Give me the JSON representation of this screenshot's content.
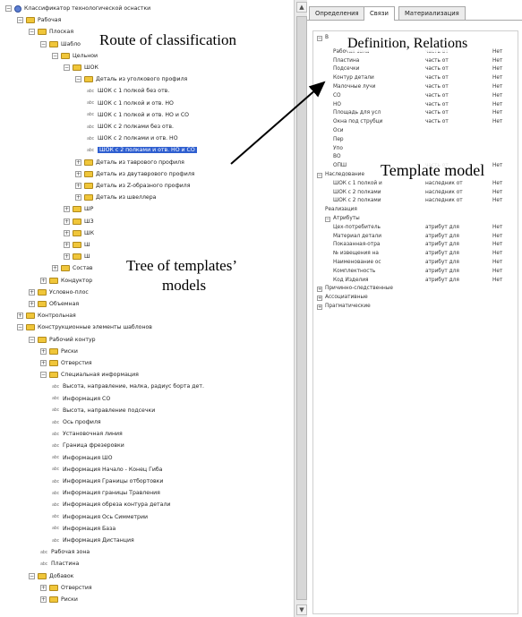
{
  "left_tree": [
    {
      "label": "Классификатор технологической оснастки",
      "indent": 0,
      "icon": "globe",
      "exp": "-"
    },
    {
      "label": "Рабочая",
      "indent": 1,
      "icon": "folder",
      "exp": "-"
    },
    {
      "label": "Плоская",
      "indent": 2,
      "icon": "folder",
      "exp": "-"
    },
    {
      "label": "Шабло",
      "indent": 3,
      "icon": "folder",
      "exp": "-"
    },
    {
      "label": "Цельнои",
      "indent": 4,
      "icon": "folder",
      "exp": "-"
    },
    {
      "label": "ШОК",
      "indent": 5,
      "icon": "folder",
      "exp": "-"
    },
    {
      "label": "Деталь из уголкового профиля",
      "indent": 6,
      "icon": "folder",
      "exp": "-"
    },
    {
      "label": "ШОК с 1 полкой без отв.",
      "indent": 7,
      "icon": "leaf",
      "exp": ""
    },
    {
      "label": "ШОК с 1 полкой и отв. НО",
      "indent": 7,
      "icon": "leaf",
      "exp": ""
    },
    {
      "label": "ШОК с 1 полкой и отв. НО и СО",
      "indent": 7,
      "icon": "leaf",
      "exp": ""
    },
    {
      "label": "ШОК с 2 полками без отв.",
      "indent": 7,
      "icon": "leaf",
      "exp": ""
    },
    {
      "label": "ШОК с 2 полками и отв. НО",
      "indent": 7,
      "icon": "leaf",
      "exp": ""
    },
    {
      "label": "ШОК с 2 полками и отв. НО и СО",
      "indent": 7,
      "icon": "leaf",
      "exp": "",
      "selected": true
    },
    {
      "label": "Деталь из таврового профиля",
      "indent": 6,
      "icon": "folder",
      "exp": "+"
    },
    {
      "label": "Деталь из двутаврового профиля",
      "indent": 6,
      "icon": "folder",
      "exp": "+"
    },
    {
      "label": "Деталь из Z-образного профиля",
      "indent": 6,
      "icon": "folder",
      "exp": "+"
    },
    {
      "label": "Деталь из швеллера",
      "indent": 6,
      "icon": "folder",
      "exp": "+"
    },
    {
      "label": "ШР",
      "indent": 5,
      "icon": "folder",
      "exp": "+"
    },
    {
      "label": "ШЗ",
      "indent": 5,
      "icon": "folder",
      "exp": "+"
    },
    {
      "label": "ШК",
      "indent": 5,
      "icon": "folder",
      "exp": "+"
    },
    {
      "label": "Ш",
      "indent": 5,
      "icon": "folder",
      "exp": "+"
    },
    {
      "label": "Ш",
      "indent": 5,
      "icon": "folder",
      "exp": "+"
    },
    {
      "label": "Состав",
      "indent": 4,
      "icon": "folder",
      "exp": "+"
    },
    {
      "label": "Кондуктор",
      "indent": 3,
      "icon": "folder",
      "exp": "+"
    },
    {
      "label": "Условно-плос",
      "indent": 2,
      "icon": "folder",
      "exp": "+"
    },
    {
      "label": "Объемная",
      "indent": 2,
      "icon": "folder",
      "exp": "+"
    },
    {
      "label": "Контрольная",
      "indent": 1,
      "icon": "folder",
      "exp": "+"
    },
    {
      "label": "Конструкционные элементы шаблонов",
      "indent": 1,
      "icon": "folder",
      "exp": "-"
    },
    {
      "label": "Рабочий контур",
      "indent": 2,
      "icon": "folder",
      "exp": "-"
    },
    {
      "label": "Риски",
      "indent": 3,
      "icon": "folder",
      "exp": "+"
    },
    {
      "label": "Отверстия",
      "indent": 3,
      "icon": "folder",
      "exp": "+"
    },
    {
      "label": "Специальная информация",
      "indent": 3,
      "icon": "folder",
      "exp": "-"
    },
    {
      "label": "Высота, направление, малка, радиус борта дет.",
      "indent": 4,
      "icon": "leaf",
      "exp": ""
    },
    {
      "label": "Информация СО",
      "indent": 4,
      "icon": "leaf",
      "exp": ""
    },
    {
      "label": "Высота, направление подсечки",
      "indent": 4,
      "icon": "leaf",
      "exp": ""
    },
    {
      "label": "Ось профиля",
      "indent": 4,
      "icon": "leaf",
      "exp": ""
    },
    {
      "label": "Установочная линия",
      "indent": 4,
      "icon": "leaf",
      "exp": ""
    },
    {
      "label": "Граница фрезеровки",
      "indent": 4,
      "icon": "leaf",
      "exp": ""
    },
    {
      "label": "Информация ШО",
      "indent": 4,
      "icon": "leaf",
      "exp": ""
    },
    {
      "label": "Информация Начало - Конец Гиба",
      "indent": 4,
      "icon": "leaf",
      "exp": ""
    },
    {
      "label": "Информация Границы отбортовки",
      "indent": 4,
      "icon": "leaf",
      "exp": ""
    },
    {
      "label": "Информация границы Травления",
      "indent": 4,
      "icon": "leaf",
      "exp": ""
    },
    {
      "label": "Информация обреза контура детали",
      "indent": 4,
      "icon": "leaf",
      "exp": ""
    },
    {
      "label": "Информация Ось Симметрии",
      "indent": 4,
      "icon": "leaf",
      "exp": ""
    },
    {
      "label": "Информация База",
      "indent": 4,
      "icon": "leaf",
      "exp": ""
    },
    {
      "label": "Информация Дистанция",
      "indent": 4,
      "icon": "leaf",
      "exp": ""
    },
    {
      "label": "Рабочая зона",
      "indent": 3,
      "icon": "leaf",
      "exp": ""
    },
    {
      "label": "Пластина",
      "indent": 3,
      "icon": "leaf",
      "exp": ""
    },
    {
      "label": "Добавок",
      "indent": 2,
      "icon": "folder",
      "exp": "-"
    },
    {
      "label": "Отверстия",
      "indent": 3,
      "icon": "folder",
      "exp": "+"
    },
    {
      "label": "Риски",
      "indent": 3,
      "icon": "folder",
      "exp": "+"
    }
  ],
  "tabs": [
    "Определения",
    "Связи",
    "Материализация"
  ],
  "active_tab": 1,
  "right_rows": [
    {
      "name": "В",
      "rel": "",
      "val": "",
      "indent": 0,
      "exp": "-"
    },
    {
      "name": "Рабочая зона",
      "rel": "часть от",
      "val": "Нет",
      "indent": 2
    },
    {
      "name": "Пластина",
      "rel": "часть от",
      "val": "Нет",
      "indent": 2
    },
    {
      "name": "Подсечки",
      "rel": "часть от",
      "val": "Нет",
      "indent": 2
    },
    {
      "name": "Контур детали",
      "rel": "часть от",
      "val": "Нет",
      "indent": 2
    },
    {
      "name": "Малочные лучи",
      "rel": "часть от",
      "val": "Нет",
      "indent": 2
    },
    {
      "name": "СО",
      "rel": "часть от",
      "val": "Нет",
      "indent": 2
    },
    {
      "name": "НО",
      "rel": "часть от",
      "val": "Нет",
      "indent": 2
    },
    {
      "name": "Площадь для усл",
      "rel": "часть от",
      "val": "Нет",
      "indent": 2
    },
    {
      "name": "Окна под струбци",
      "rel": "часть от",
      "val": "Нет",
      "indent": 2
    },
    {
      "name": "Оси",
      "rel": "",
      "val": "",
      "indent": 2
    },
    {
      "name": "Пер",
      "rel": "",
      "val": "",
      "indent": 2
    },
    {
      "name": "Упо",
      "rel": "",
      "val": "",
      "indent": 2
    },
    {
      "name": "ВО",
      "rel": "",
      "val": "",
      "indent": 2
    },
    {
      "name": "ОПШ",
      "rel": "часть от",
      "val": "Нет",
      "indent": 2
    },
    {
      "name": "Наследование",
      "rel": "",
      "val": "",
      "indent": 0,
      "exp": "-"
    },
    {
      "name": "ШОК с 1 полкой и",
      "rel": "наследник от",
      "val": "Нет",
      "indent": 2
    },
    {
      "name": "ШОК с 2 полками",
      "rel": "наследник от",
      "val": "Нет",
      "indent": 2
    },
    {
      "name": "ШОК с 2 полками",
      "rel": "наследник от",
      "val": "Нет",
      "indent": 2
    },
    {
      "name": "Реализация",
      "rel": "",
      "val": "",
      "indent": 1
    },
    {
      "name": "Атрибуты",
      "rel": "",
      "val": "",
      "indent": 1,
      "exp": "-"
    },
    {
      "name": "Цех-потребитель",
      "rel": "атрибут для",
      "val": "Нет",
      "indent": 2
    },
    {
      "name": "Материал детали",
      "rel": "атрибут для",
      "val": "Нет",
      "indent": 2
    },
    {
      "name": "Показанная-отра",
      "rel": "атрибут для",
      "val": "Нет",
      "indent": 2
    },
    {
      "name": "№ извещения на",
      "rel": "атрибут для",
      "val": "Нет",
      "indent": 2
    },
    {
      "name": "Наименование ос",
      "rel": "атрибут для",
      "val": "Нет",
      "indent": 2
    },
    {
      "name": "Комплектность",
      "rel": "атрибут для",
      "val": "Нет",
      "indent": 2
    },
    {
      "name": "Код Изделия",
      "rel": "атрибут для",
      "val": "Нет",
      "indent": 2
    },
    {
      "name": "Причинно-следственные",
      "rel": "",
      "val": "",
      "indent": 0,
      "exp": "+"
    },
    {
      "name": "Ассоциативные",
      "rel": "",
      "val": "",
      "indent": 0,
      "exp": "+"
    },
    {
      "name": "Прагматические",
      "rel": "",
      "val": "",
      "indent": 0,
      "exp": "+"
    }
  ],
  "annotations": {
    "route": "Route of classification",
    "definition": "Definition, Relations",
    "template_model": "Template model",
    "tree_line1": "Tree of templates’",
    "tree_line2": "models"
  }
}
